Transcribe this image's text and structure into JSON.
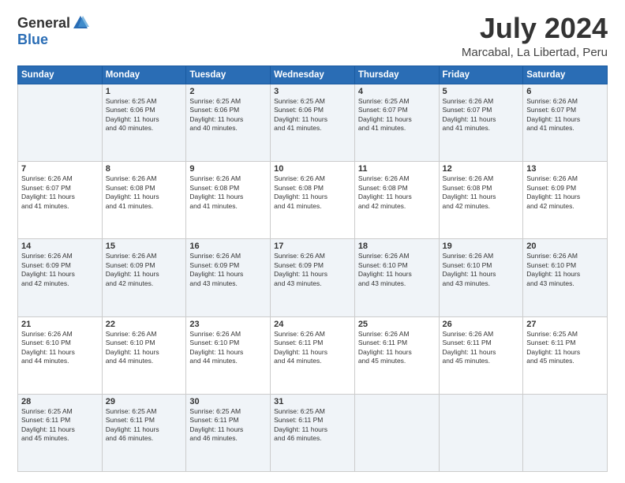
{
  "header": {
    "logo_general": "General",
    "logo_blue": "Blue",
    "month_year": "July 2024",
    "location": "Marcabal, La Libertad, Peru"
  },
  "days_of_week": [
    "Sunday",
    "Monday",
    "Tuesday",
    "Wednesday",
    "Thursday",
    "Friday",
    "Saturday"
  ],
  "weeks": [
    [
      {
        "day": null,
        "info": null
      },
      {
        "day": "1",
        "info": "Sunrise: 6:25 AM\nSunset: 6:06 PM\nDaylight: 11 hours\nand 40 minutes."
      },
      {
        "day": "2",
        "info": "Sunrise: 6:25 AM\nSunset: 6:06 PM\nDaylight: 11 hours\nand 40 minutes."
      },
      {
        "day": "3",
        "info": "Sunrise: 6:25 AM\nSunset: 6:06 PM\nDaylight: 11 hours\nand 41 minutes."
      },
      {
        "day": "4",
        "info": "Sunrise: 6:25 AM\nSunset: 6:07 PM\nDaylight: 11 hours\nand 41 minutes."
      },
      {
        "day": "5",
        "info": "Sunrise: 6:26 AM\nSunset: 6:07 PM\nDaylight: 11 hours\nand 41 minutes."
      },
      {
        "day": "6",
        "info": "Sunrise: 6:26 AM\nSunset: 6:07 PM\nDaylight: 11 hours\nand 41 minutes."
      }
    ],
    [
      {
        "day": "7",
        "info": "Sunrise: 6:26 AM\nSunset: 6:07 PM\nDaylight: 11 hours\nand 41 minutes."
      },
      {
        "day": "8",
        "info": "Sunrise: 6:26 AM\nSunset: 6:08 PM\nDaylight: 11 hours\nand 41 minutes."
      },
      {
        "day": "9",
        "info": "Sunrise: 6:26 AM\nSunset: 6:08 PM\nDaylight: 11 hours\nand 41 minutes."
      },
      {
        "day": "10",
        "info": "Sunrise: 6:26 AM\nSunset: 6:08 PM\nDaylight: 11 hours\nand 41 minutes."
      },
      {
        "day": "11",
        "info": "Sunrise: 6:26 AM\nSunset: 6:08 PM\nDaylight: 11 hours\nand 42 minutes."
      },
      {
        "day": "12",
        "info": "Sunrise: 6:26 AM\nSunset: 6:08 PM\nDaylight: 11 hours\nand 42 minutes."
      },
      {
        "day": "13",
        "info": "Sunrise: 6:26 AM\nSunset: 6:09 PM\nDaylight: 11 hours\nand 42 minutes."
      }
    ],
    [
      {
        "day": "14",
        "info": "Sunrise: 6:26 AM\nSunset: 6:09 PM\nDaylight: 11 hours\nand 42 minutes."
      },
      {
        "day": "15",
        "info": "Sunrise: 6:26 AM\nSunset: 6:09 PM\nDaylight: 11 hours\nand 42 minutes."
      },
      {
        "day": "16",
        "info": "Sunrise: 6:26 AM\nSunset: 6:09 PM\nDaylight: 11 hours\nand 43 minutes."
      },
      {
        "day": "17",
        "info": "Sunrise: 6:26 AM\nSunset: 6:09 PM\nDaylight: 11 hours\nand 43 minutes."
      },
      {
        "day": "18",
        "info": "Sunrise: 6:26 AM\nSunset: 6:10 PM\nDaylight: 11 hours\nand 43 minutes."
      },
      {
        "day": "19",
        "info": "Sunrise: 6:26 AM\nSunset: 6:10 PM\nDaylight: 11 hours\nand 43 minutes."
      },
      {
        "day": "20",
        "info": "Sunrise: 6:26 AM\nSunset: 6:10 PM\nDaylight: 11 hours\nand 43 minutes."
      }
    ],
    [
      {
        "day": "21",
        "info": "Sunrise: 6:26 AM\nSunset: 6:10 PM\nDaylight: 11 hours\nand 44 minutes."
      },
      {
        "day": "22",
        "info": "Sunrise: 6:26 AM\nSunset: 6:10 PM\nDaylight: 11 hours\nand 44 minutes."
      },
      {
        "day": "23",
        "info": "Sunrise: 6:26 AM\nSunset: 6:10 PM\nDaylight: 11 hours\nand 44 minutes."
      },
      {
        "day": "24",
        "info": "Sunrise: 6:26 AM\nSunset: 6:11 PM\nDaylight: 11 hours\nand 44 minutes."
      },
      {
        "day": "25",
        "info": "Sunrise: 6:26 AM\nSunset: 6:11 PM\nDaylight: 11 hours\nand 45 minutes."
      },
      {
        "day": "26",
        "info": "Sunrise: 6:26 AM\nSunset: 6:11 PM\nDaylight: 11 hours\nand 45 minutes."
      },
      {
        "day": "27",
        "info": "Sunrise: 6:25 AM\nSunset: 6:11 PM\nDaylight: 11 hours\nand 45 minutes."
      }
    ],
    [
      {
        "day": "28",
        "info": "Sunrise: 6:25 AM\nSunset: 6:11 PM\nDaylight: 11 hours\nand 45 minutes."
      },
      {
        "day": "29",
        "info": "Sunrise: 6:25 AM\nSunset: 6:11 PM\nDaylight: 11 hours\nand 46 minutes."
      },
      {
        "day": "30",
        "info": "Sunrise: 6:25 AM\nSunset: 6:11 PM\nDaylight: 11 hours\nand 46 minutes."
      },
      {
        "day": "31",
        "info": "Sunrise: 6:25 AM\nSunset: 6:11 PM\nDaylight: 11 hours\nand 46 minutes."
      },
      {
        "day": null,
        "info": null
      },
      {
        "day": null,
        "info": null
      },
      {
        "day": null,
        "info": null
      }
    ]
  ]
}
